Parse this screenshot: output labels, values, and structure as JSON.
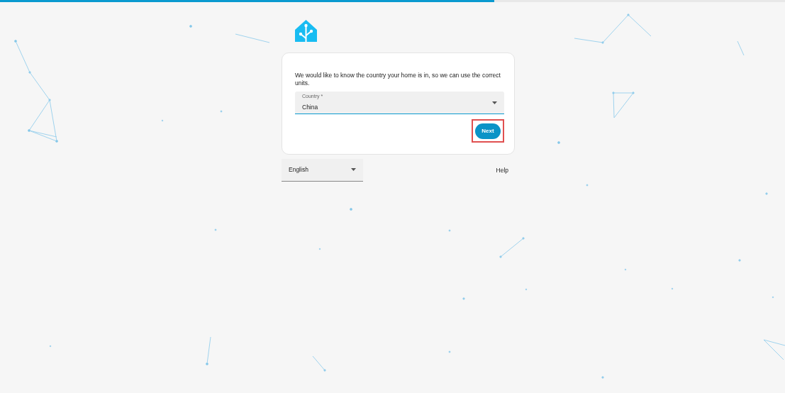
{
  "progress": {
    "level": 0.63
  },
  "card": {
    "message": "We would like to know the country your home is in, so we can use the correct units.",
    "country_field": {
      "label": "Country *",
      "value": "China"
    },
    "next_button": {
      "label": "Next",
      "highlighted": true
    }
  },
  "footer": {
    "language": "English",
    "help": "Help"
  }
}
